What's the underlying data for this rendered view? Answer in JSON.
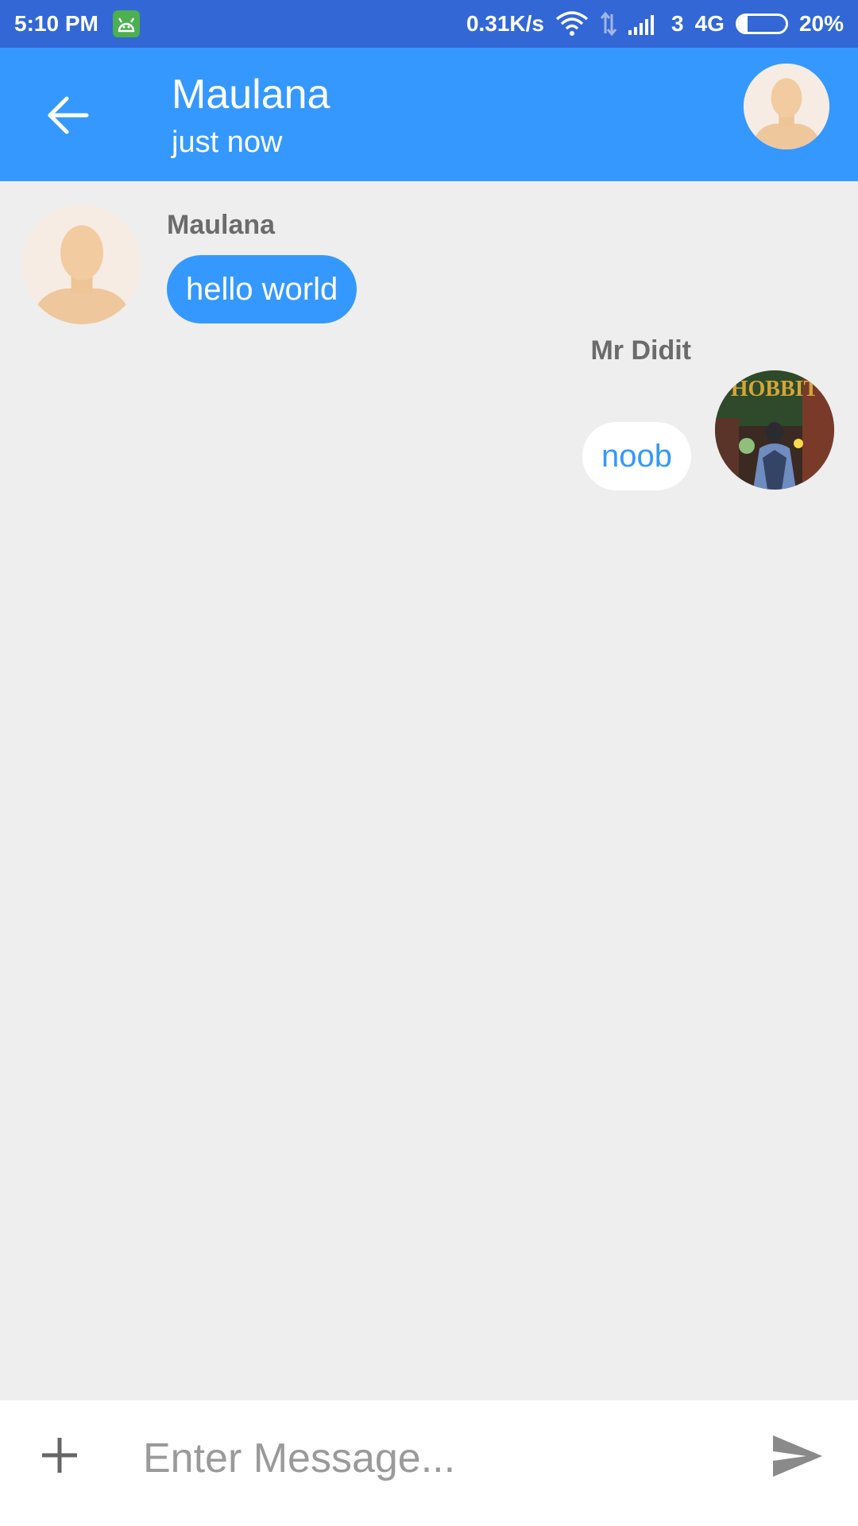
{
  "status_bar": {
    "time": "5:10 PM",
    "network_speed": "0.31K/s",
    "sim_slot": "3",
    "network_type": "4G",
    "battery_text": "20%",
    "battery_level": 0.2,
    "icons": [
      "android-icon",
      "wifi-icon",
      "data-transfer-icon",
      "signal-icon",
      "battery-icon"
    ]
  },
  "header": {
    "back_icon": "arrow-left-icon",
    "title": "Maulana",
    "subtitle": "just now",
    "avatar_icon": "default-user-avatar"
  },
  "messages": [
    {
      "sender": "Maulana",
      "text": "hello world",
      "direction": "incoming",
      "avatar": "default-user-avatar"
    },
    {
      "sender": "Mr Didit",
      "text": "noob",
      "direction": "outgoing",
      "avatar": "user-photo-avatar",
      "avatar_text": "HOBBIT"
    }
  ],
  "composer": {
    "add_icon": "plus-icon",
    "placeholder": "Enter Message...",
    "value": "",
    "send_icon": "send-icon"
  },
  "colors": {
    "status_bar": "#3367d6",
    "app_bar": "#3598fe",
    "background": "#eeeeee",
    "incoming_bubble": "#3598fe",
    "outgoing_bubble": "#ffffff",
    "sender_name": "#6b6b6b"
  }
}
